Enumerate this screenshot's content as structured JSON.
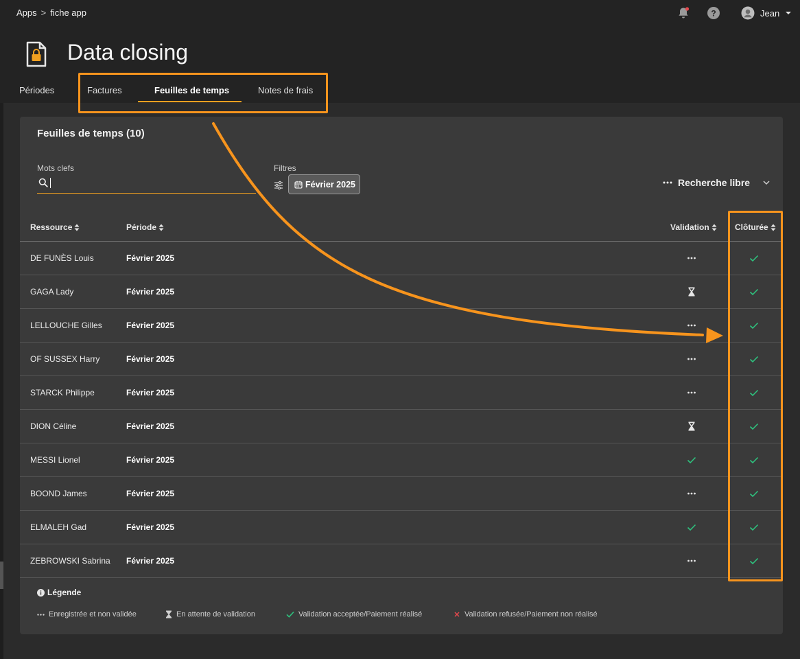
{
  "breadcrumb": {
    "root": "Apps",
    "separator": ">",
    "current": "fiche app"
  },
  "user": {
    "name": "Jean"
  },
  "page": {
    "title": "Data closing"
  },
  "tabs": [
    {
      "label": "Périodes",
      "active": false
    },
    {
      "label": "Factures",
      "active": false
    },
    {
      "label": "Feuilles de temps",
      "active": true
    },
    {
      "label": "Notes de frais",
      "active": false
    }
  ],
  "card": {
    "title": "Feuilles de temps (10)",
    "keywords_label": "Mots clefs",
    "keywords_value": "",
    "filters_label": "Filtres",
    "filter_chip": "Février 2025",
    "free_search": "Recherche libre"
  },
  "table": {
    "columns": [
      "Ressource",
      "Période",
      "Validation",
      "Clôturée"
    ],
    "rows": [
      {
        "ressource": "DE FUNÈS Louis",
        "periode": "Février 2025",
        "validation": "dots",
        "cloturee": "check"
      },
      {
        "ressource": "GAGA Lady",
        "periode": "Février 2025",
        "validation": "hourglass",
        "cloturee": "check"
      },
      {
        "ressource": "LELLOUCHE Gilles",
        "periode": "Février 2025",
        "validation": "dots",
        "cloturee": "check"
      },
      {
        "ressource": "OF SUSSEX Harry",
        "periode": "Février 2025",
        "validation": "dots",
        "cloturee": "check"
      },
      {
        "ressource": "STARCK Philippe",
        "periode": "Février 2025",
        "validation": "dots",
        "cloturee": "check"
      },
      {
        "ressource": "DION Céline",
        "periode": "Février 2025",
        "validation": "hourglass",
        "cloturee": "check"
      },
      {
        "ressource": "MESSI Lionel",
        "periode": "Février 2025",
        "validation": "check",
        "cloturee": "check"
      },
      {
        "ressource": "BOOND James",
        "periode": "Février 2025",
        "validation": "dots",
        "cloturee": "check"
      },
      {
        "ressource": "ELMALEH Gad",
        "periode": "Février 2025",
        "validation": "check",
        "cloturee": "check"
      },
      {
        "ressource": "ZEBROWSKI Sabrina",
        "periode": "Février 2025",
        "validation": "dots",
        "cloturee": "check"
      }
    ]
  },
  "legend": {
    "title": "Légende",
    "items": [
      {
        "icon": "dots-icon",
        "label": "Enregistrée et non validée"
      },
      {
        "icon": "hourglass-icon",
        "label": "En attente de validation"
      },
      {
        "icon": "check-icon",
        "label": "Validation acceptée/Paiement réalisé"
      },
      {
        "icon": "cross-icon",
        "label": "Validation refusée/Paiement non réalisé"
      }
    ]
  },
  "colors": {
    "accent": "#f0a020",
    "annotation": "#f7941d",
    "check": "#2ec27e",
    "cross": "#e5484d",
    "notification": "#e5484d"
  }
}
